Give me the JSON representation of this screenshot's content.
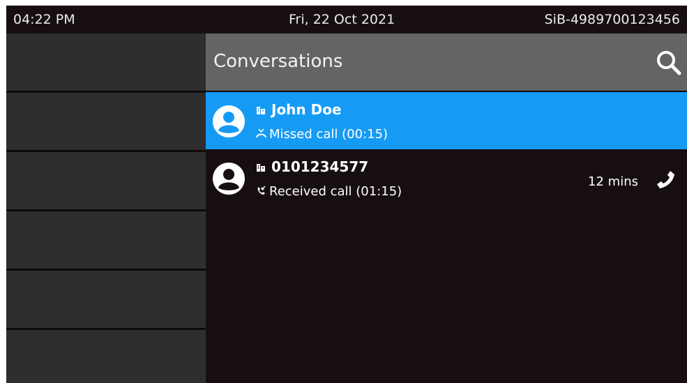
{
  "status_bar": {
    "time": "04:22 PM",
    "date": "Fri, 22 Oct 2021",
    "device_id": "SiB-4989700123456"
  },
  "header": {
    "title": "Conversations",
    "search_icon": "search-icon"
  },
  "conversations": [
    {
      "name": "John Doe",
      "detail": "Missed call (00:15)",
      "detail_icon": "missed-call-icon",
      "time": "",
      "selected": true
    },
    {
      "name": "0101234577",
      "detail": "Received call (01:15)",
      "detail_icon": "received-call-icon",
      "time": "12 mins",
      "selected": false
    }
  ],
  "colors": {
    "background": "#170f0f",
    "softkey": "#2e2e2e",
    "header": "#646464",
    "selected": "#169bf5"
  }
}
